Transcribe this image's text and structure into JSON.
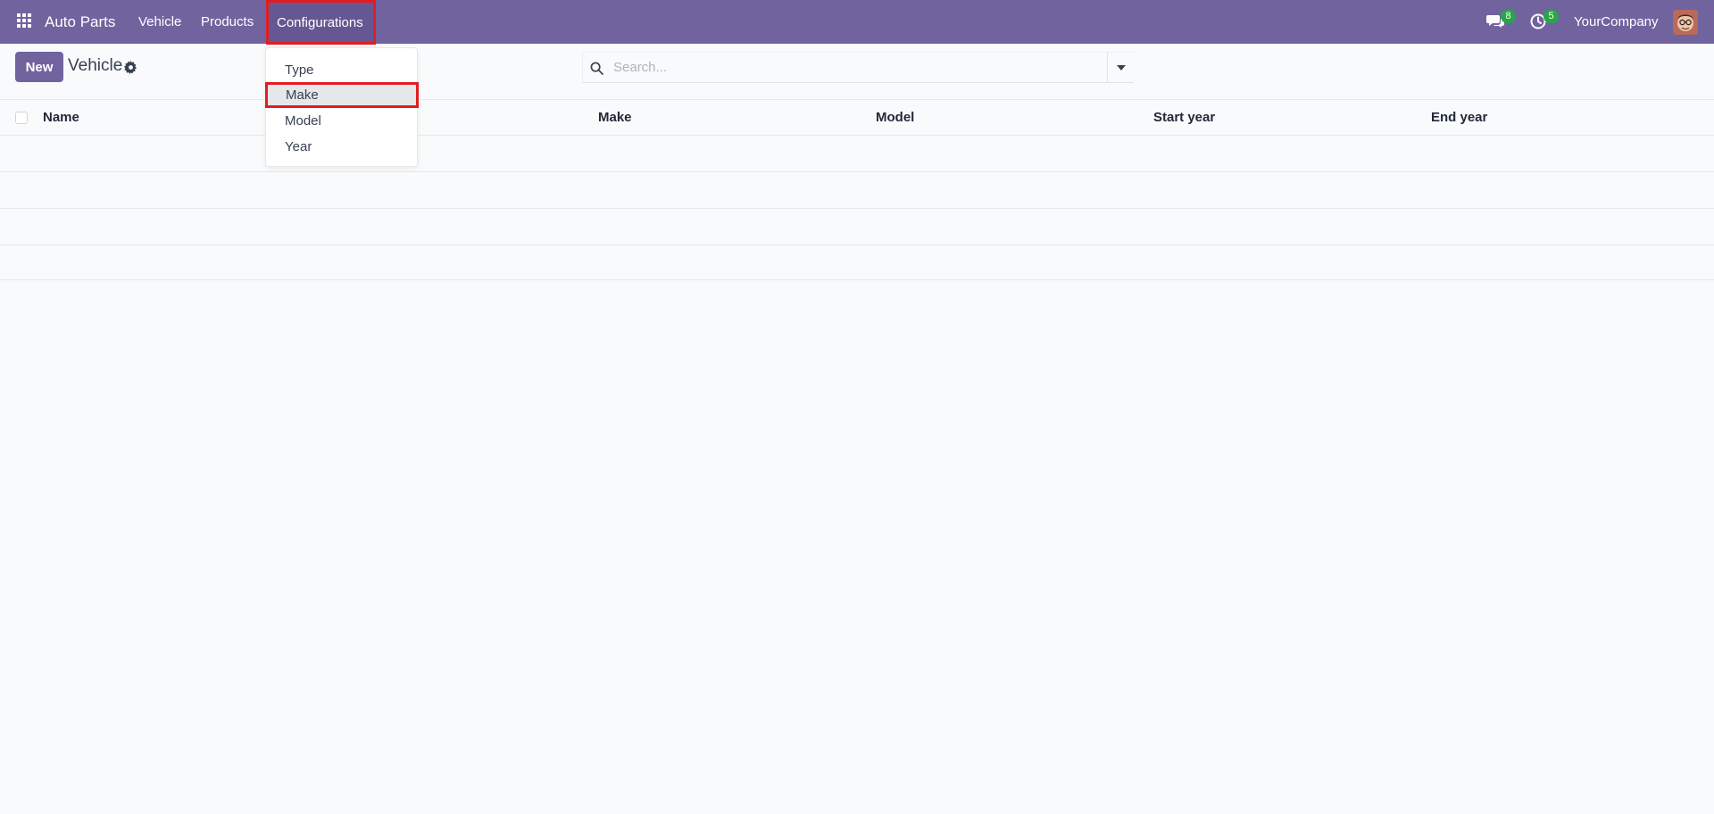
{
  "navbar": {
    "app_name": "Auto Parts",
    "menu": {
      "vehicle": "Vehicle",
      "products": "Products",
      "configurations": "Configurations"
    },
    "chat_badge": "8",
    "activity_badge": "5",
    "company": "YourCompany",
    "accent_color": "#71639e"
  },
  "control_panel": {
    "new_label": "New",
    "title": "Vehicle",
    "search_placeholder": "Search..."
  },
  "table": {
    "columns": [
      "Name",
      "Make",
      "Model",
      "Start year",
      "End year"
    ],
    "rows": []
  },
  "configurations_dropdown": {
    "items": [
      "Type",
      "Make",
      "Model",
      "Year"
    ],
    "highlighted": "Make"
  },
  "icons": [
    "apps-grid-icon",
    "chat-icon",
    "clock-icon",
    "gear-icon",
    "search-icon",
    "caret-down-icon"
  ]
}
